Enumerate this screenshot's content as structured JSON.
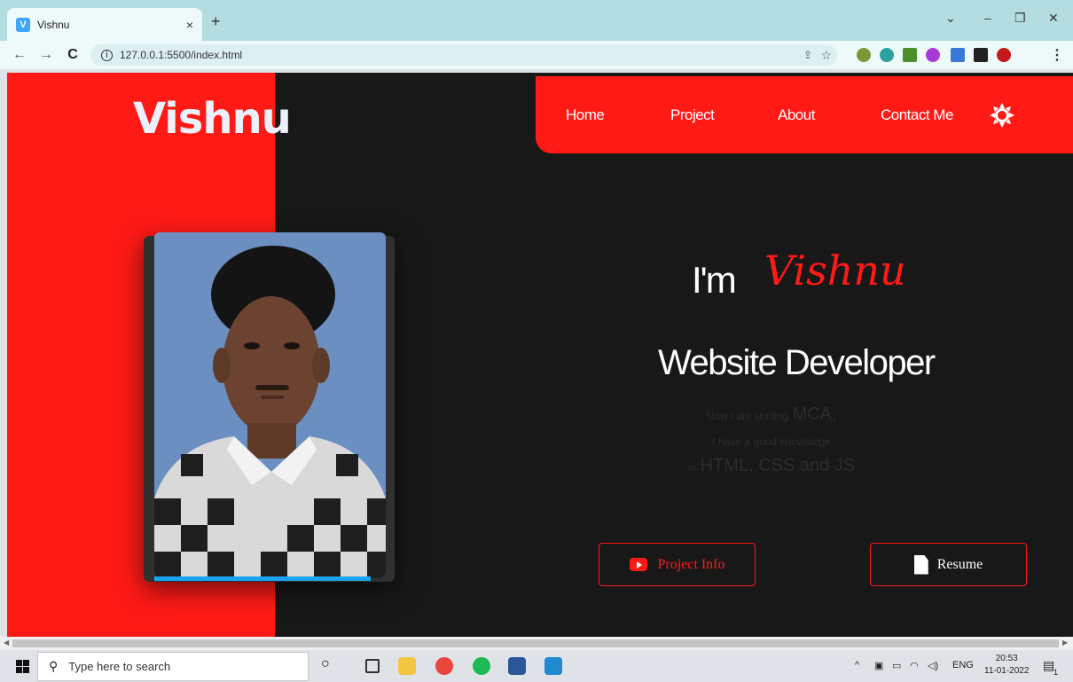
{
  "browser": {
    "tab_title": "Vishnu",
    "tab_favicon": "V",
    "tab_close": "×",
    "new_tab": "+",
    "url": "127.0.0.1:5500/index.html",
    "minimize": "–",
    "restore": "❐",
    "close": "✕",
    "tab_search": "⌄"
  },
  "site": {
    "logo": "Vishnu",
    "nav": [
      "Home",
      "Project",
      "About",
      "Contact Me"
    ],
    "greeting_prefix": "I'm",
    "greeting_name": "Vishnu",
    "role": "Website Developer",
    "desc": {
      "line1_small": "Now I am studing",
      "line1_big": "MCA,",
      "line2_small": "I have a good knowladge",
      "line3_small": "in",
      "line3_big": "HTML, CSS and JS"
    },
    "buttons": {
      "project": "Project Info",
      "resume": "Resume"
    },
    "colors": {
      "accent": "#ff1a16",
      "background": "#181818",
      "progress": "#18a4f0"
    }
  },
  "taskbar": {
    "search_placeholder": "Type here to search",
    "tray_lang": "ENG",
    "time": "20:53",
    "date": "11-01-2022",
    "notification_count": "1"
  }
}
